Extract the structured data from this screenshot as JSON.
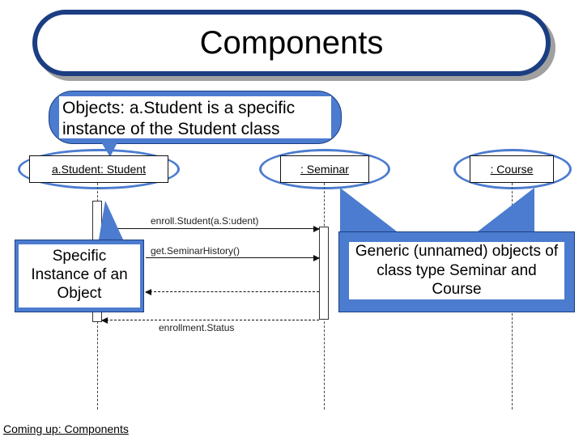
{
  "title": "Components",
  "description": "Objects: a.Student is a specific instance of the Student class",
  "objects": {
    "student": "a.Student: Student",
    "seminar": ": Seminar",
    "course": ": Course"
  },
  "callouts": {
    "specific": "Specific Instance of an Object",
    "generic": "Generic (unnamed) objects of class type Seminar and Course"
  },
  "messages": {
    "enroll": "enroll.Student(a.S:udent)",
    "getHistory": "get.SeminarHistory()",
    "status": "enrollment.Status"
  },
  "footer": "Coming up: Components"
}
